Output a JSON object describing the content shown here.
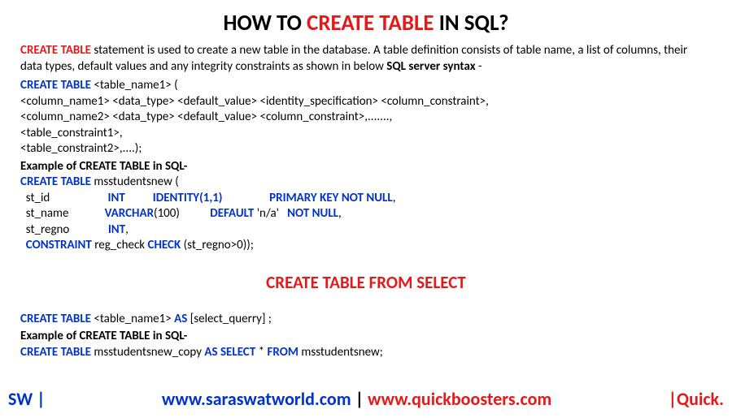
{
  "title": {
    "part1": "HOW TO ",
    "highlight": "CREATE TABLE",
    "part2": " IN SQL?"
  },
  "intro": {
    "redBold": "CREATE TABLE",
    "text1": " statement is used to create a new table in the database. A table definition consists of table name, a list of columns, their data types, default values and any integrity constraints as shown in below ",
    "bold2": "SQL server syntax",
    "text2": " -"
  },
  "syntax": {
    "keyword": "CREATE TABLE ",
    "lines": [
      "<table_name1> (",
      " <column_name1> <data_type> <default_value> <identity_specification> <column_constraint>,",
      " <column_name2> <data_type> <default_value> <column_constraint>,.......,",
      " <table_constraint1>,",
      " <table_constraint2>,....);"
    ]
  },
  "exampleLabel": "Example of CREATE TABLE in SQL-",
  "example1": {
    "line1": {
      "keyword": "CREATE TABLE ",
      "table": "msstudentsnew ("
    },
    "cols": [
      {
        "name": "  st_id",
        "type": "INT",
        "identity": "IDENTITY(1,1)",
        "constraint": "PRIMARY KEY NOT NULL",
        "comma": ","
      },
      {
        "name": "  st_name",
        "type": "VARCHAR",
        "typeArg": "(100)",
        "default": "DEFAULT",
        "defaultVal": " 'n/a'   ",
        "constraint": "NOT NULL",
        "comma": ","
      },
      {
        "name": "  st_regno",
        "type": "INT",
        "comma": ","
      }
    ],
    "constraint": {
      "kw1": "  CONSTRAINT ",
      "name": "reg_check ",
      "kw2": "CHECK ",
      "expr": "(st_regno>0));"
    }
  },
  "sectionTitle": "CREATE TABLE FROM SELECT",
  "syntax2": {
    "keyword": "CREATE TABLE ",
    "text1": "<table_name1> ",
    "as": "AS ",
    "text2": "[select_querry] ;"
  },
  "example2Label": "Example of CREATE TABLE in SQL-",
  "example2": {
    "kw1": "CREATE TABLE ",
    "table": "msstudentsnew_copy ",
    "kw2": "AS SELECT ",
    "star": "* ",
    "kw3": "FROM ",
    "table2": "msstudentsnew;"
  },
  "footer": {
    "left": "SW |",
    "url1": "www.saraswatworld.com",
    "sep": " | ",
    "url2": "www.quickboosters.com",
    "right": "|Quick."
  }
}
